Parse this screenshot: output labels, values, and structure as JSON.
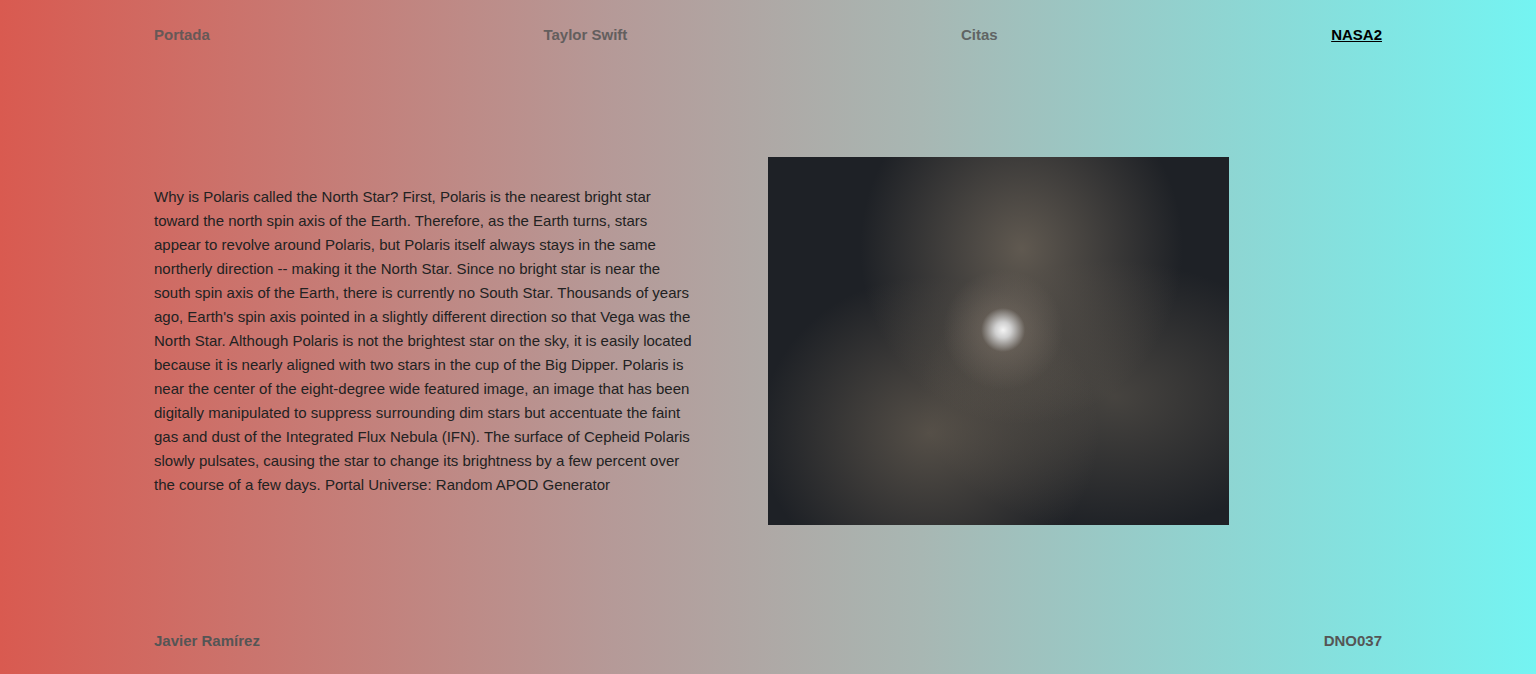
{
  "nav": {
    "items": [
      {
        "label": "Portada",
        "selected": false
      },
      {
        "label": "Taylor Swift",
        "selected": false
      },
      {
        "label": "Citas",
        "selected": false
      },
      {
        "label": "NASA2",
        "selected": true
      }
    ]
  },
  "article": {
    "text": "Why is Polaris called the North Star? First, Polaris is the nearest bright star toward the north spin axis of the Earth. Therefore, as the Earth turns, stars appear to revolve around Polaris, but Polaris itself always stays in the same northerly direction -- making it the North Star. Since no bright star is near the south spin axis of the Earth, there is currently no South Star. Thousands of years ago, Earth's spin axis pointed in a slightly different direction so that Vega was the North Star. Although Polaris is not the brightest star on the sky, it is easily located because it is nearly aligned with two stars in the cup of the Big Dipper. Polaris is near the center of the eight-degree wide featured image, an image that has been digitally manipulated to suppress surrounding dim stars but accentuate the faint gas and dust of the Integrated Flux Nebula (IFN). The surface of Cepheid Polaris slowly pulsates, causing the star to change its brightness by a few percent over the course of a few days. Portal Universe: Random APOD Generator"
  },
  "footer": {
    "author": "Javier Ramírez",
    "code": "DNO037"
  }
}
